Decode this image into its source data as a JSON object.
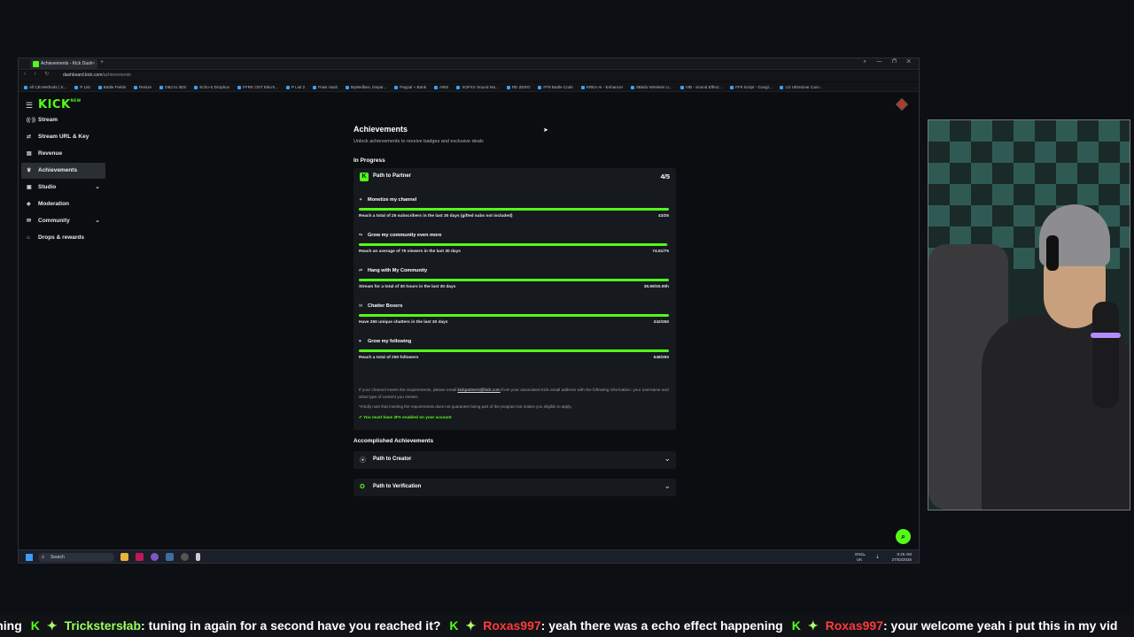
{
  "browser": {
    "tab_title": "Achievements - Kick Dash",
    "url_host": "dashboard.kick.com",
    "url_path": "/achievements",
    "bookmarks": [
      "All CB Methods | S...",
      "P List",
      "Battle Fields",
      "Resize",
      "OBJ to 3DS",
      "Echo-S Dropbox",
      "FFRK OST Eiko's...",
      "P List 2",
      "Pass Vault",
      "MyWelfare, Depar...",
      "Paypal + Bank",
      "AWS",
      "XOFXV Sound Mo...",
      "RE ZERO",
      "FF8 Battle Code",
      "KREA AI - Enhancer",
      "8Bitdo Wireless U...",
      "VIB - Sound Effect...",
      "FF9 Script - Googl...",
      "LG UltraGear Carv..."
    ]
  },
  "logo": {
    "text": "KICK",
    "tag": "NEW"
  },
  "sidebar": {
    "items": [
      {
        "label": "Stream",
        "icon": "broadcast-icon"
      },
      {
        "label": "Stream URL & Key",
        "icon": "link-icon"
      },
      {
        "label": "Revenue",
        "icon": "revenue-icon"
      },
      {
        "label": "Achievements",
        "icon": "trophy-icon",
        "active": true
      },
      {
        "label": "Studio",
        "icon": "studio-icon",
        "expandable": true
      },
      {
        "label": "Moderation",
        "icon": "shield-icon"
      },
      {
        "label": "Community",
        "icon": "community-icon",
        "expandable": true
      },
      {
        "label": "Drops & rewards",
        "icon": "gift-icon"
      }
    ]
  },
  "main": {
    "title": "Achievements",
    "subtitle": "Unlock achievements to receive badges and exclusive deals",
    "in_progress_heading": "In Progress",
    "card": {
      "title": "Path to Partner",
      "count": "4/5",
      "tasks": [
        {
          "name": "Monetize my channel",
          "desc": "Reach a total of 25 subscribers in the last 30 days (gifted subs not included)",
          "value": "43/25",
          "progress": 1.0
        },
        {
          "name": "Grow my community even more",
          "desc": "Reach an average of 75 viewers in the last 30 days",
          "value": "74.61/75",
          "progress": 0.995
        },
        {
          "name": "Hang with My Community",
          "desc": "Stream for a total of 30 hours in the last 30 days",
          "value": "39.59/30.00h",
          "progress": 1.0
        },
        {
          "name": "Chatter Boxers",
          "desc": "Have 250 unique chatters in the last 30 days",
          "value": "342/250",
          "progress": 1.0
        },
        {
          "name": "Grow my following",
          "desc": "Reach a total of 250 followers",
          "value": "548/250",
          "progress": 1.0
        }
      ],
      "note_part1": "If your channel meets the requirements, please email ",
      "note_email": "kickpartners@kick.com",
      "note_part2": " from your associated Kick email address with the following information: your username and what type of content you stream.",
      "note_disclaimer": "*Kindly note that meeting the requirements does not guarantee being part of the program but makes you eligible to apply.",
      "note_2fa": "You must have 2FA enabled on your account"
    },
    "accomplished_heading": "Accomplished Achievements",
    "accomplished": [
      {
        "label": "Path to Creator",
        "icon": "broadcast-icon"
      },
      {
        "label": "Path to Verification",
        "icon": "verified-icon"
      }
    ]
  },
  "taskbar": {
    "search_placeholder": "Search",
    "lang_line1": "ENG",
    "lang_line2": "UK",
    "time": "9:25 AM",
    "date": "27/03/2026"
  },
  "chat": {
    "messages": [
      {
        "user": "",
        "text": "t thing"
      },
      {
        "user": "Trickstersłab",
        "text": ": tuning in again for a second have you reached it?",
        "style": "user1"
      },
      {
        "user": "Roxas997",
        "text": ": yeah there was a echo effect happening",
        "style": "user2"
      },
      {
        "user": "Roxas997",
        "text": ": your welcome yeah i put this in my vid",
        "style": "user2"
      }
    ]
  },
  "colors": {
    "accent": "#53fc18",
    "background": "#0b0d10",
    "card": "#16191e"
  }
}
